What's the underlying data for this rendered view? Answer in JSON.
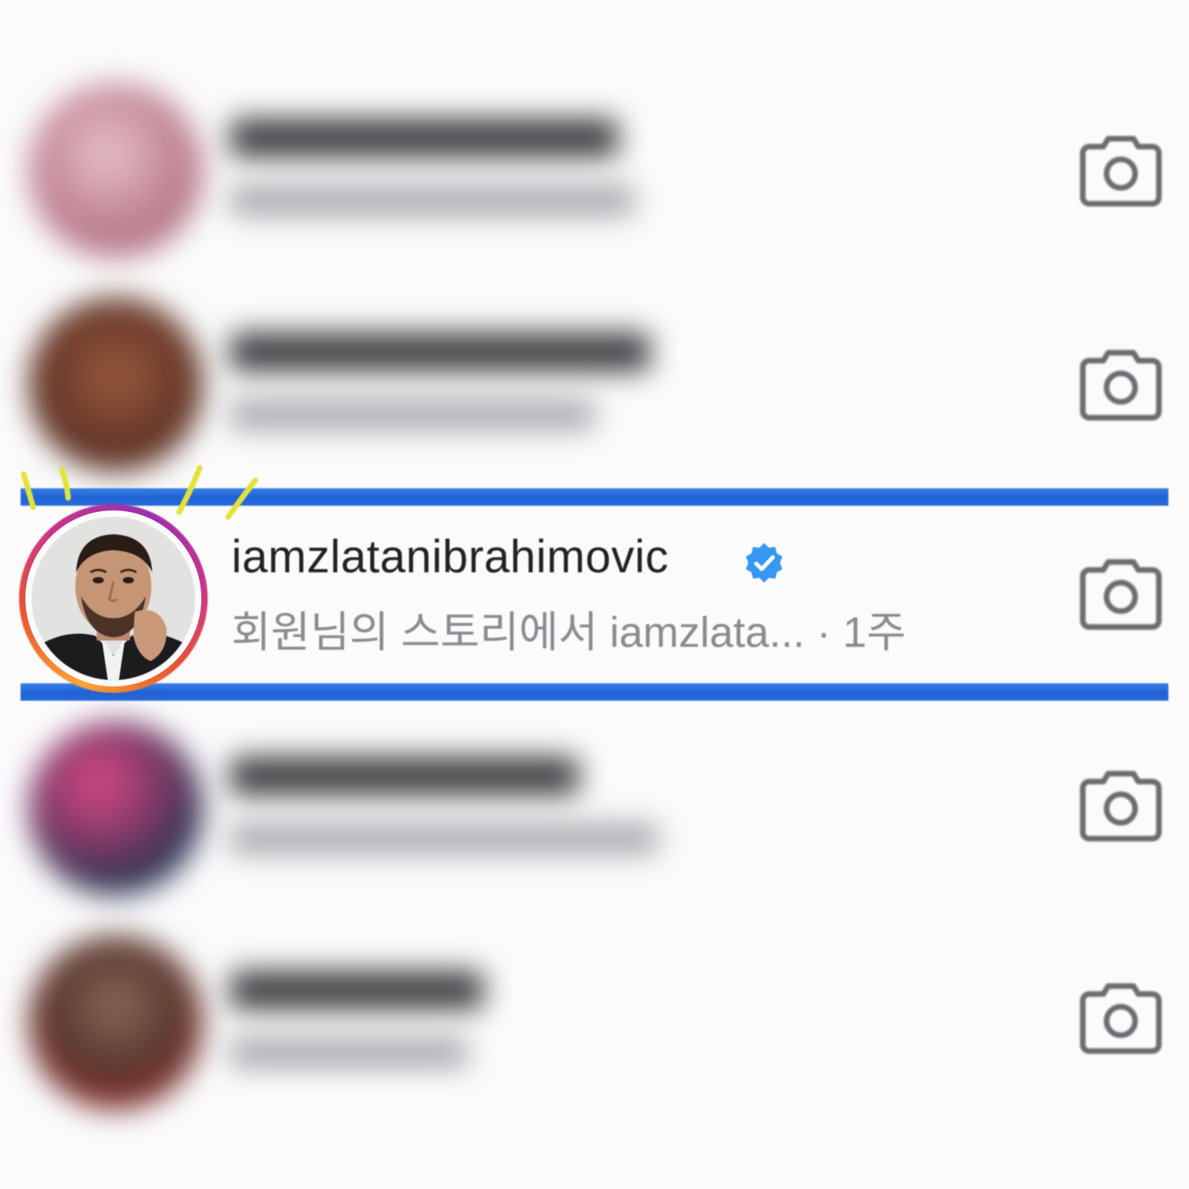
{
  "rows": [
    {
      "id": "row-1",
      "blurred": true,
      "avatar_color": "#c58a9a",
      "camera_icon": "camera-icon"
    },
    {
      "id": "row-2",
      "blurred": true,
      "avatar_color": "#6b3a2a",
      "camera_icon": "camera-icon"
    },
    {
      "id": "row-3",
      "blurred": false,
      "username": "iamzlatanibrahimovic",
      "verified_icon": "verified-badge-icon",
      "subtitle": "회원님의 스토리에서 iamzlata... · 1주",
      "camera_icon": "camera-icon"
    },
    {
      "id": "row-4",
      "blurred": true,
      "avatar_color": "#3a4a6a",
      "camera_icon": "camera-icon"
    },
    {
      "id": "row-5",
      "blurred": true,
      "avatar_color": "#5a3a30",
      "camera_icon": "camera-icon"
    }
  ],
  "colors": {
    "highlight_bar": "#1e62d4",
    "story_ring_start": "#f9a634",
    "story_ring_end": "#9b2fae",
    "verified_blue": "#3897f0",
    "scribble_yellow": "#e3e23a"
  }
}
